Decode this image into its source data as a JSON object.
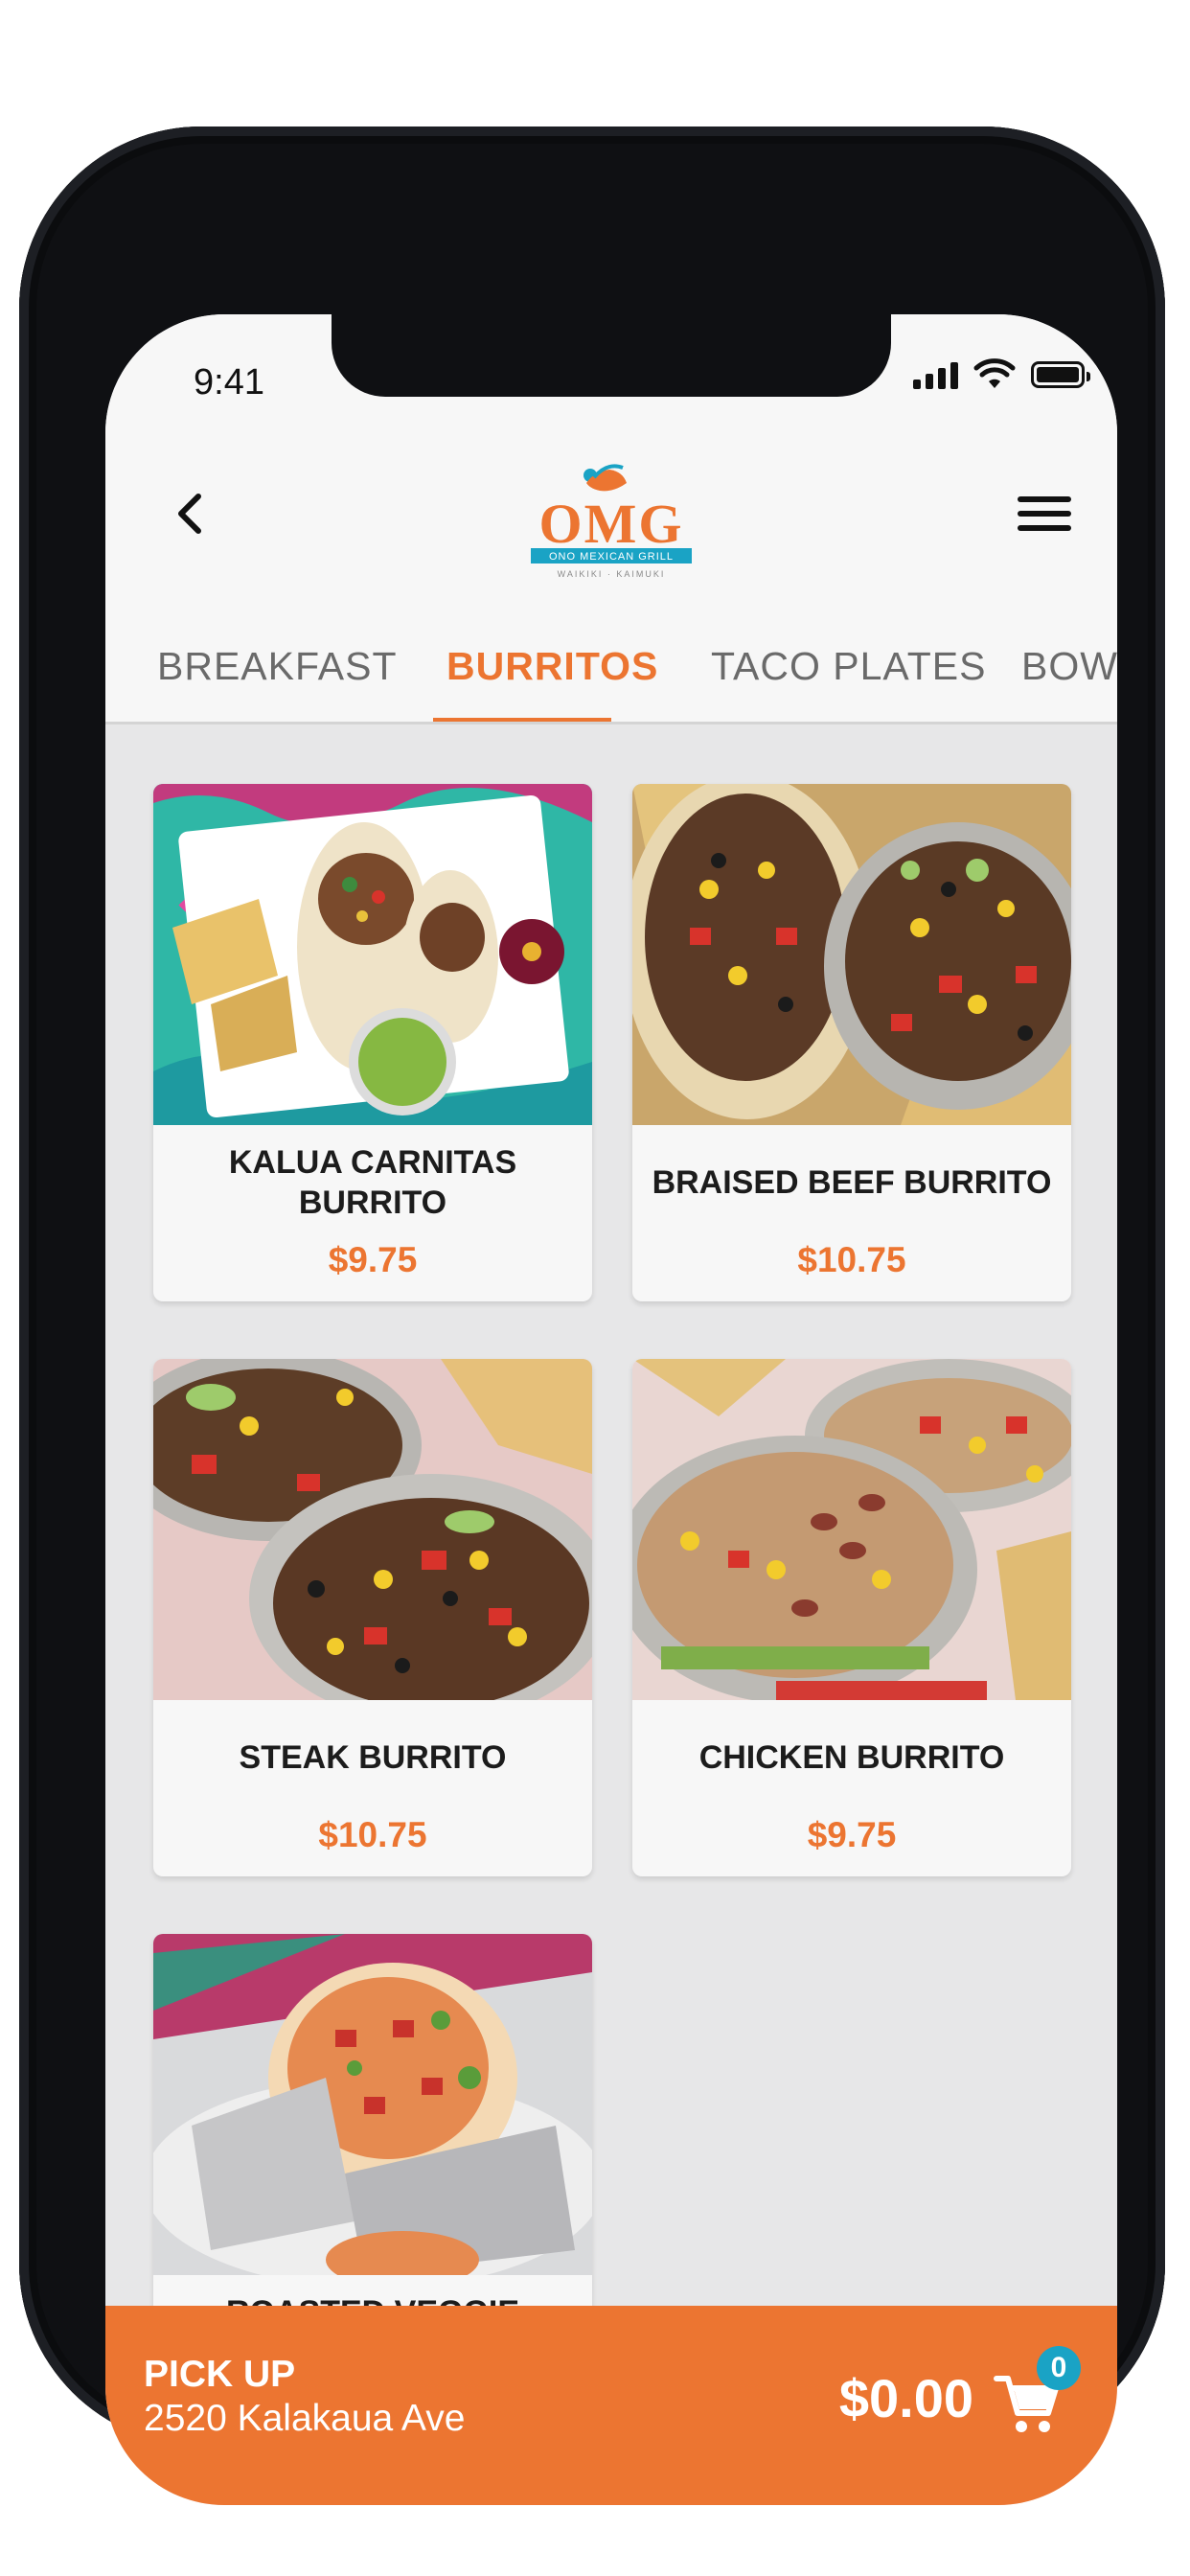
{
  "status_bar": {
    "time": "9:41"
  },
  "header": {
    "back_icon": "chevron-left-icon",
    "menu_icon": "hamburger-menu-icon",
    "logo": {
      "text": "OMG",
      "subtitle": "Ono Mexican Grill",
      "tagline": "WAIKIKI · KAIMUKI"
    }
  },
  "tabs": [
    {
      "label": "BREAKFAST",
      "active": false
    },
    {
      "label": "BURRITOS",
      "active": true
    },
    {
      "label": "TACO PLATES",
      "active": false
    },
    {
      "label": "BOWLS",
      "active": false
    }
  ],
  "menu_items": [
    {
      "name": "KALUA CARNITAS BURRITO",
      "price": "$9.75"
    },
    {
      "name": "BRAISED BEEF BURRITO",
      "price": "$10.75"
    },
    {
      "name": "STEAK BURRITO",
      "price": "$10.75"
    },
    {
      "name": "CHICKEN BURRITO",
      "price": "$9.75"
    },
    {
      "name": "ROASTED VEGGIE",
      "price": ""
    }
  ],
  "bottom_bar": {
    "pickup_label": "PICK UP",
    "address": "2520 Kalakaua Ave",
    "total": "$0.00",
    "cart_count": "0"
  },
  "colors": {
    "accent": "#ec7531",
    "badge": "#1aa3c5",
    "background": "#e7e7e8"
  }
}
